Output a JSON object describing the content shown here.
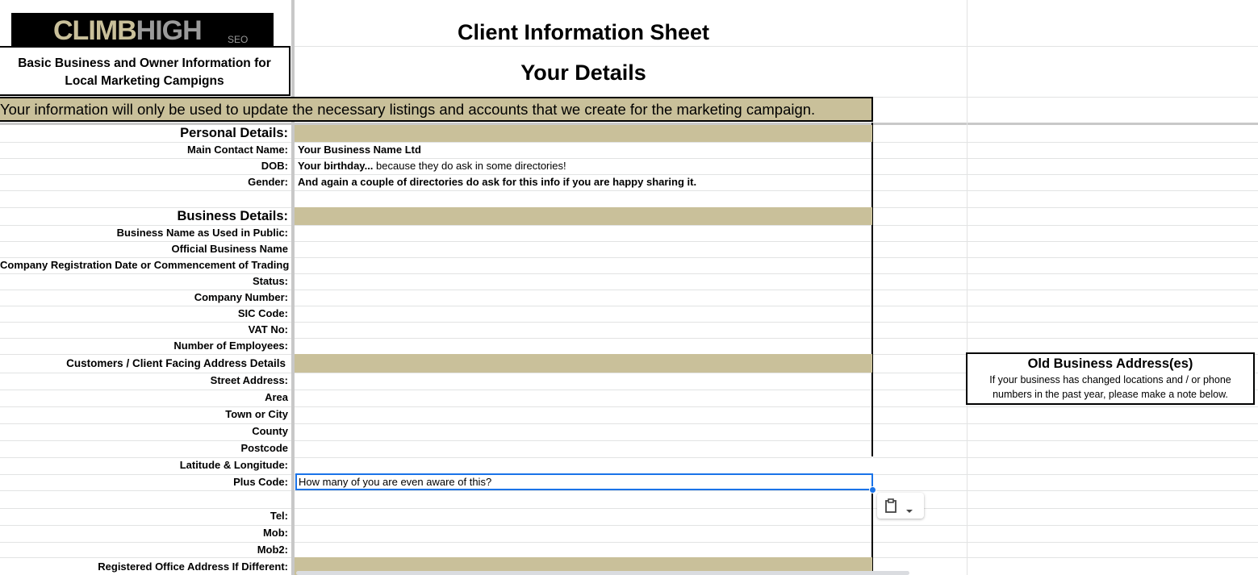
{
  "logo": {
    "main": "CLIMB",
    "accent": "HIGH",
    "sub": "SEO"
  },
  "intro_box": {
    "line1": "Basic  Business and Owner Information for",
    "line2": "Local Marketing Campigns"
  },
  "title": "Client Information Sheet",
  "subtitle": "Your Details",
  "banner": "Your information will only be used to update the necessary listings and accounts that we create for the marketing campaign.",
  "personal": {
    "heading": "Personal Details:",
    "rows": [
      {
        "label": "Main Contact Name:",
        "value_bold": "Your Business Name Ltd",
        "value_rest": ""
      },
      {
        "label": "DOB:",
        "value_bold": "Your birthday...",
        "value_rest": " because they do ask in some directories!"
      },
      {
        "label": "Gender:",
        "value_bold": "And again a couple of directories do ask for this info if you are happy sharing it.",
        "value_rest": ""
      }
    ]
  },
  "business": {
    "heading": "Business Details:",
    "rows": [
      "Business Name as Used in Public:",
      "Official Business Name",
      "Company Registration Date or Commencement of Trading",
      "Status:",
      "Company Number:",
      "SIC Code:",
      "VAT No:",
      "Number of Employees:"
    ]
  },
  "address": {
    "heading": "Customers / Client Facing Address Details",
    "rows": [
      "Street Address:",
      "Area",
      "Town or City",
      "County",
      "Postcode",
      "Latitude & Longitude:"
    ],
    "plus_code_label": "Plus Code:",
    "plus_code_value": "How many of you are even aware of this?"
  },
  "contact": {
    "tel": "Tel:",
    "mob": "Mob:",
    "mob2": "Mob2:"
  },
  "registered": "Registered Office Address If Different:",
  "old_address": {
    "title": "Old Business Address(es)",
    "line1": "If your business has changed locations and / or phone",
    "line2": "numbers in the past year, please make a note below."
  },
  "colors": {
    "tan": "#c9c09a",
    "selection": "#1a73e8",
    "gridline": "#e2e3e3"
  },
  "icons": {
    "paste": "clipboard-icon",
    "dropdown": "chevron-down-icon"
  }
}
